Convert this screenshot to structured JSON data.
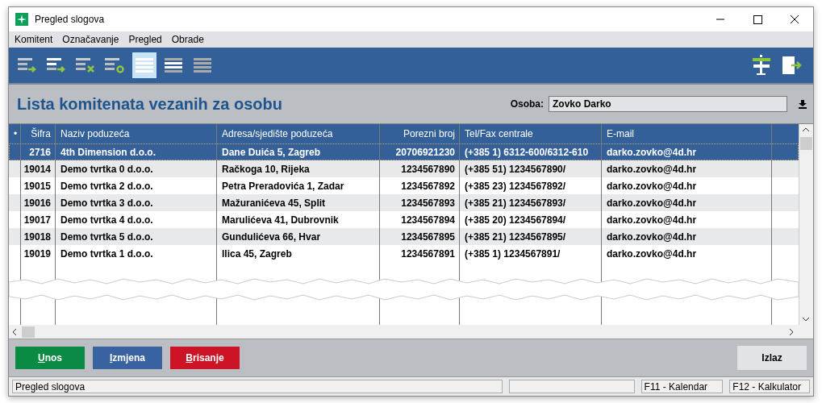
{
  "window": {
    "title": "Pregled slogova"
  },
  "menu": [
    "Komitent",
    "Označavanje",
    "Pregled",
    "Obrade"
  ],
  "toolbar": [
    {
      "kind": "add",
      "selected": false
    },
    {
      "kind": "add-bold",
      "selected": false
    },
    {
      "kind": "delete",
      "selected": false
    },
    {
      "kind": "refresh",
      "selected": false
    },
    {
      "kind": "list-all",
      "selected": true
    },
    {
      "kind": "list-marked",
      "selected": false
    },
    {
      "kind": "list-gray",
      "selected": false
    }
  ],
  "heading": "Lista komitenata vezanih za osobu",
  "person": {
    "label": "Osoba:",
    "value": "Zovko Darko"
  },
  "table": {
    "columns": [
      "•",
      "Šifra",
      "Naziv poduzeća",
      "Adresa/sjedište poduzeća",
      "Porezni broj",
      "Tel/Fax centrale",
      "E-mail"
    ],
    "rows": [
      {
        "selected": true,
        "cells": [
          "",
          "2716",
          "4th Dimension d.o.o.",
          "Dane Duića 5, Zagreb",
          "20706921230",
          "(+385 1) 6312-600/6312-610",
          "darko.zovko@4d.hr"
        ]
      },
      {
        "selected": false,
        "cells": [
          "",
          "19014",
          "Demo tvrtka 0 d.o.o.",
          "Račkoga 10, Rijeka",
          "1234567890",
          "(+385 51) 1234567890/",
          "darko.zovko@4d.hr"
        ]
      },
      {
        "selected": false,
        "cells": [
          "",
          "19015",
          "Demo tvrtka 2 d.o.o.",
          "Petra Preradovića 1, Zadar",
          "1234567892",
          "(+385 23) 1234567892/",
          "darko.zovko@4d.hr"
        ]
      },
      {
        "selected": false,
        "cells": [
          "",
          "19016",
          "Demo tvrtka 3 d.o.o.",
          "Mažuranićeva 45, Split",
          "1234567893",
          "(+385 21) 1234567893/",
          "darko.zovko@4d.hr"
        ]
      },
      {
        "selected": false,
        "cells": [
          "",
          "19017",
          "Demo tvrtka 4 d.o.o.",
          "Marulićeva 41, Dubrovnik",
          "1234567894",
          "(+385 20) 1234567894/",
          "darko.zovko@4d.hr"
        ]
      },
      {
        "selected": false,
        "cells": [
          "",
          "19018",
          "Demo tvrtka 5 d.o.o.",
          "Gundulićeva 66, Hvar",
          "1234567895",
          "(+385 21) 1234567895/",
          "darko.zovko@4d.hr"
        ]
      },
      {
        "selected": false,
        "cells": [
          "",
          "19019",
          "Demo tvrtka 1 d.o.o.",
          "Ilica 45, Zagreb",
          "1234567891",
          "(+385 1) 1234567891/",
          "darko.zovko@4d.hr"
        ]
      }
    ]
  },
  "buttons": [
    {
      "label": "Unos",
      "kind": "green"
    },
    {
      "label": "Izmjena",
      "kind": "blue"
    },
    {
      "label": "Brisanje",
      "kind": "red"
    }
  ],
  "exit_button": "Izlaz",
  "status_bar": [
    "Pregled slogova",
    "F11 - Kalendar",
    "F12 - Kalkulator"
  ]
}
